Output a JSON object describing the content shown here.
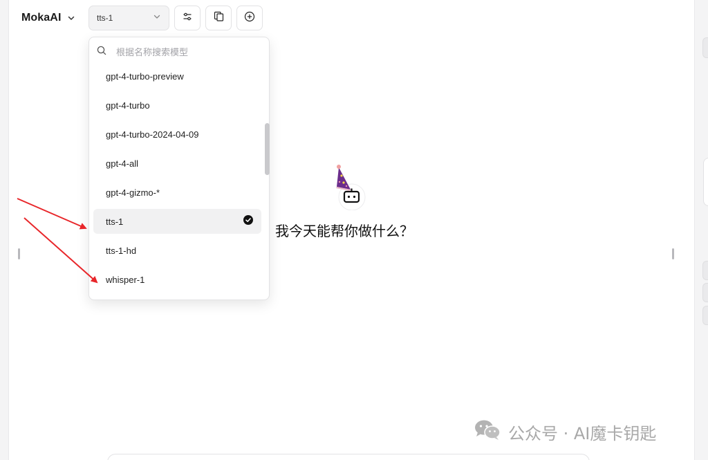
{
  "header": {
    "brand": "MokaAI",
    "model_select_value": "tts-1",
    "buttons": [
      {
        "name": "settings",
        "icon": "sliders-icon"
      },
      {
        "name": "copy",
        "icon": "copy-icon"
      },
      {
        "name": "new-chat",
        "icon": "plus-circle-icon"
      }
    ]
  },
  "dropdown": {
    "search_placeholder": "根据名称搜索模型",
    "items": [
      {
        "label": "gpt-4-turbo-preview",
        "selected": false
      },
      {
        "label": "gpt-4-turbo",
        "selected": false
      },
      {
        "label": "gpt-4-turbo-2024-04-09",
        "selected": false
      },
      {
        "label": "gpt-4-all",
        "selected": false
      },
      {
        "label": "gpt-4-gizmo-*",
        "selected": false
      },
      {
        "label": "tts-1",
        "selected": true
      },
      {
        "label": "tts-1-hd",
        "selected": false
      },
      {
        "label": "whisper-1",
        "selected": false
      }
    ]
  },
  "welcome": {
    "text": "我今天能帮你做什么？"
  },
  "watermark": {
    "text": "公众号 · AI魔卡钥匙"
  },
  "colors": {
    "accent_arrow": "#e8262a",
    "selected_bg": "#f1f1f2",
    "hat_purple": "#6b2d8c"
  }
}
